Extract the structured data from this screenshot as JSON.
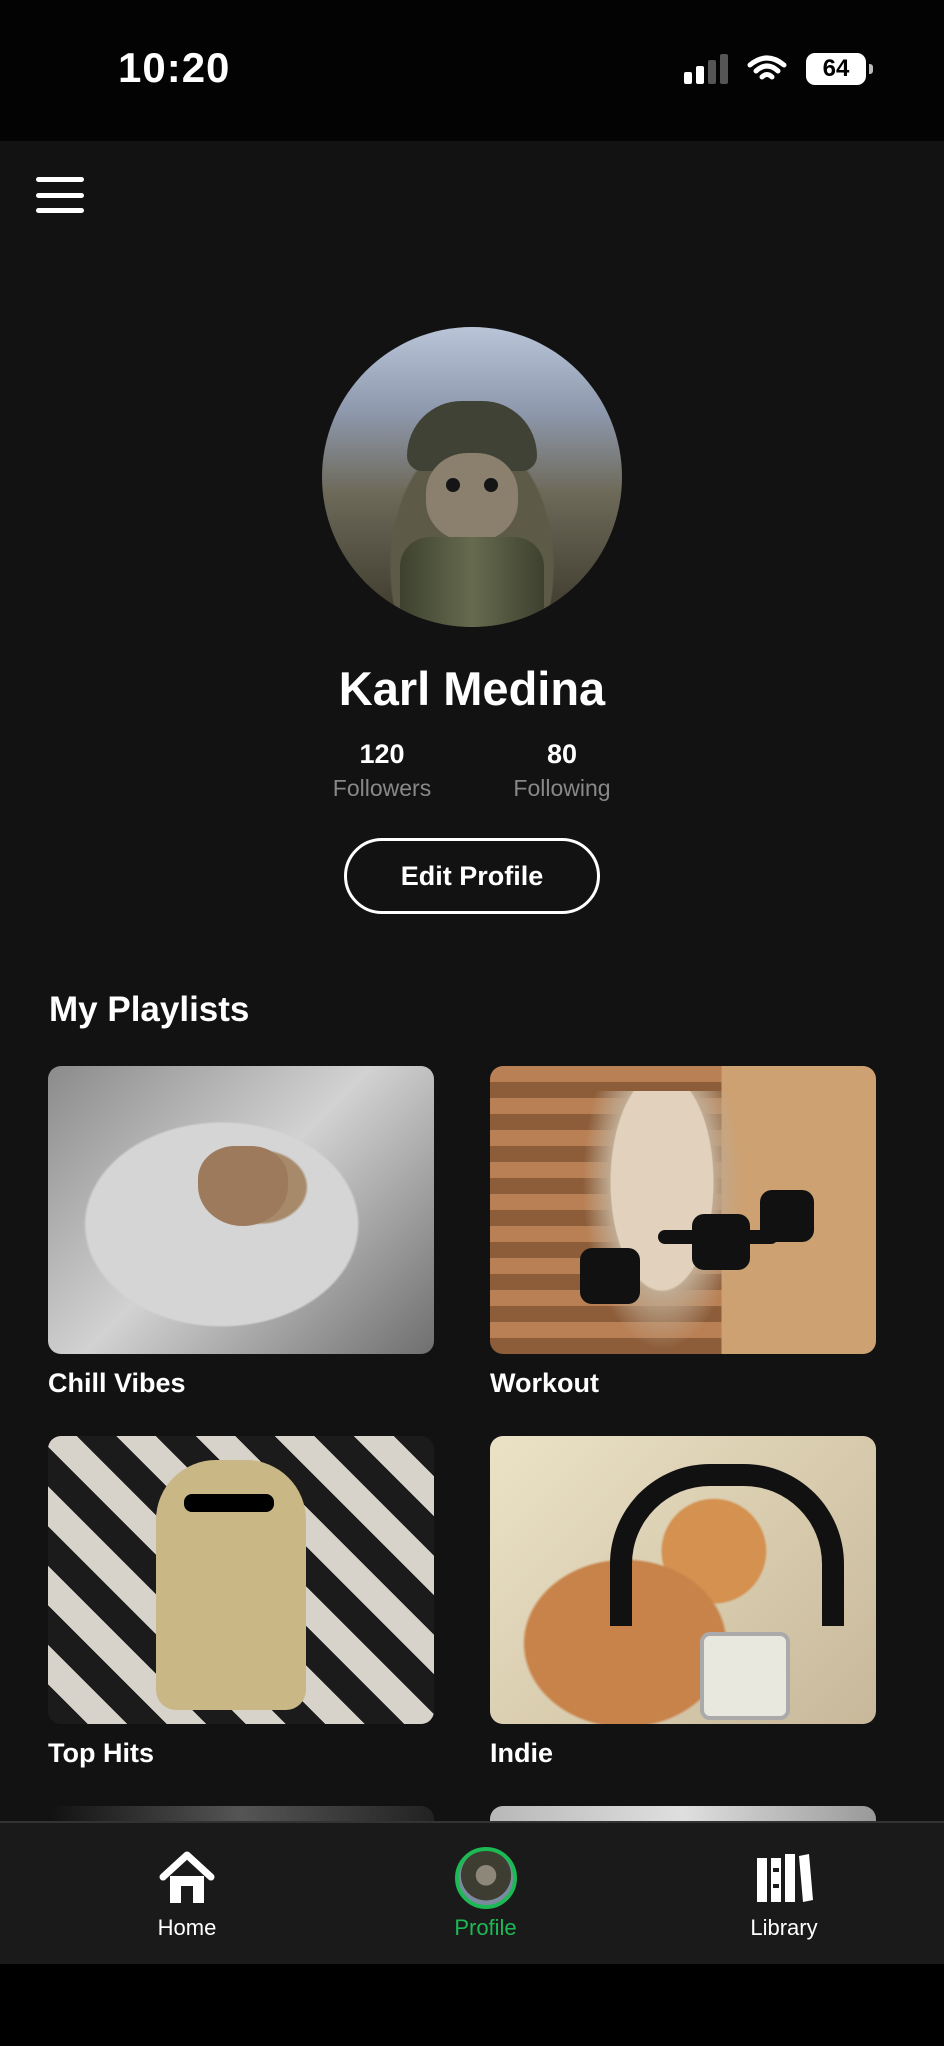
{
  "status_bar": {
    "time": "10:20",
    "battery": "64"
  },
  "header": {
    "menu_icon": "menu-icon"
  },
  "profile": {
    "name": "Karl Medina",
    "followers": {
      "value": "120",
      "label": "Followers"
    },
    "following": {
      "value": "80",
      "label": "Following"
    },
    "edit_button_label": "Edit Profile"
  },
  "playlists": {
    "title": "My Playlists",
    "items": [
      {
        "label": "Chill Vibes",
        "image": "cat-in-hood-image"
      },
      {
        "label": "Workout",
        "image": "cat-workout-image"
      },
      {
        "label": "Top Hits",
        "image": "dj-cat-image"
      },
      {
        "label": "Indie",
        "image": "cat-headphones-image"
      }
    ]
  },
  "bottom_nav": {
    "items": [
      {
        "label": "Home",
        "icon": "home-icon"
      },
      {
        "label": "Profile",
        "icon": "profile-avatar-icon",
        "active": true
      },
      {
        "label": "Library",
        "icon": "library-icon"
      }
    ]
  },
  "colors": {
    "background": "#121212",
    "accent": "#1db954",
    "text": "#ffffff",
    "muted": "#888888"
  }
}
